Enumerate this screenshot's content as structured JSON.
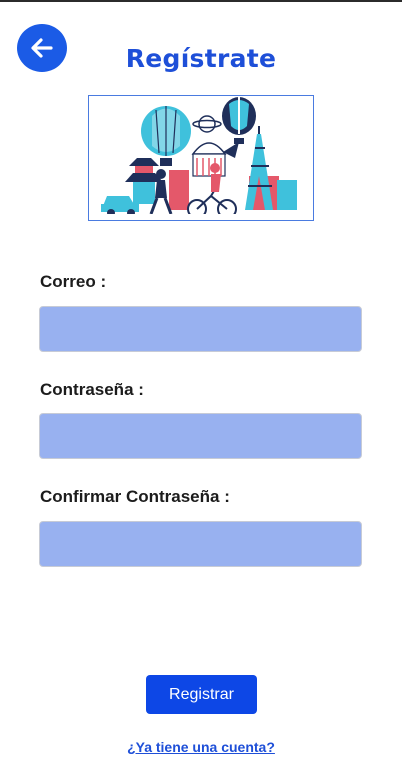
{
  "header": {
    "back_icon": "arrow-left-icon",
    "title": "Regístrate"
  },
  "illustration": {
    "name": "travel-landmarks-illustration"
  },
  "form": {
    "email_label": "Correo :",
    "email_value": "",
    "password_label": "Contraseña :",
    "password_value": "",
    "confirm_label": "Confirmar Contraseña :",
    "confirm_value": "",
    "submit_label": "Registrar"
  },
  "footer": {
    "login_link": "¿Ya tiene una cuenta?"
  },
  "colors": {
    "accent": "#1b5be6",
    "title": "#1e4fd8",
    "field_bg": "#98b1f0",
    "button_bg": "#0d47e6"
  }
}
